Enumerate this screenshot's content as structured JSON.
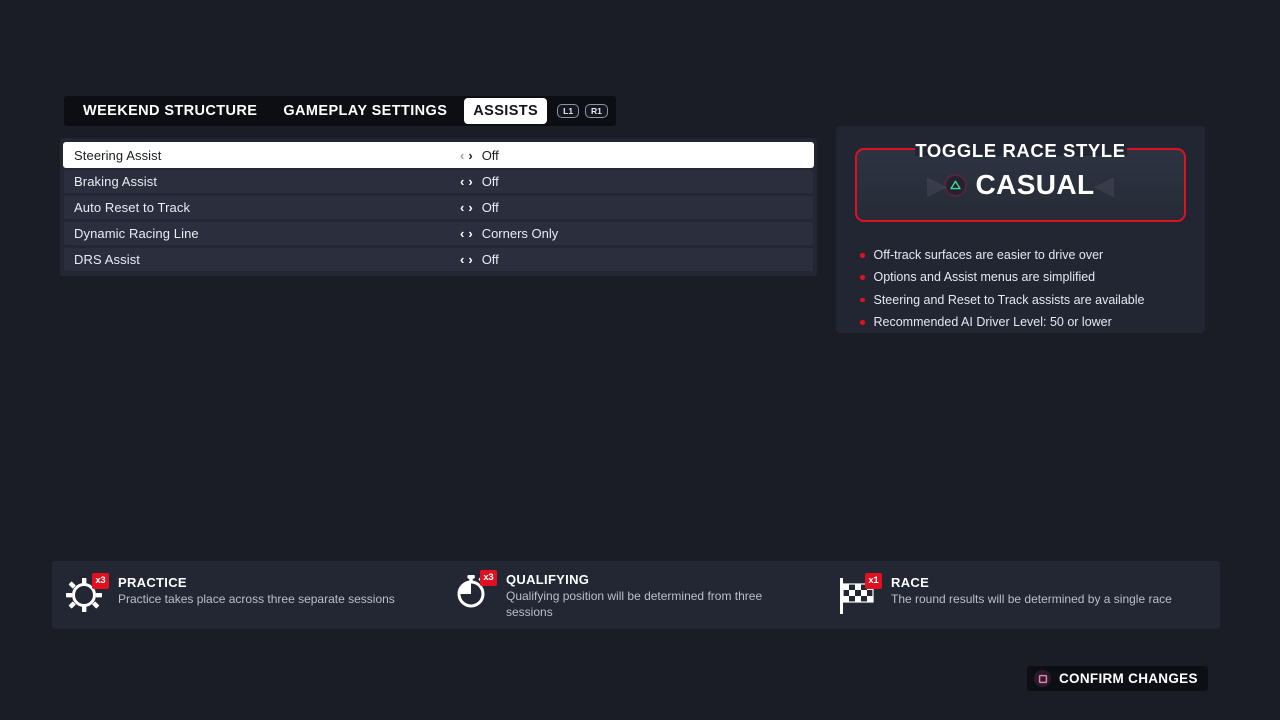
{
  "tabs": [
    {
      "label": "WEEKEND STRUCTURE",
      "active": false
    },
    {
      "label": "GAMEPLAY SETTINGS",
      "active": false
    },
    {
      "label": "ASSISTS",
      "active": true
    }
  ],
  "shoulder_buttons": [
    {
      "label": "L1"
    },
    {
      "label": "R1"
    }
  ],
  "settings_rows": [
    {
      "label": "Steering Assist",
      "value": "Off",
      "selected": true
    },
    {
      "label": "Braking Assist",
      "value": "Off",
      "selected": false
    },
    {
      "label": "Auto Reset to Track",
      "value": "Off",
      "selected": false
    },
    {
      "label": "Dynamic Racing Line",
      "value": "Corners Only",
      "selected": false
    },
    {
      "label": "DRS Assist",
      "value": "Off",
      "selected": false
    }
  ],
  "race_style": {
    "title": "TOGGLE RACE STYLE",
    "value": "CASUAL",
    "button_icon": "playstation-triangle-icon",
    "left_arrow": "◀",
    "right_arrow": "▶",
    "bullets": [
      "Off-track surfaces are easier to drive over",
      "Options and Assist menus are simplified",
      "Steering and Reset to Track assists are available",
      "Recommended AI Driver Level: 50 or lower"
    ]
  },
  "sessions": [
    {
      "title": "PRACTICE",
      "count": "x3",
      "icon": "gear-icon",
      "description": "Practice takes place across three separate sessions"
    },
    {
      "title": "QUALIFYING",
      "count": "x3",
      "icon": "stopwatch-icon",
      "description": "Qualifying position will be determined from three sessions"
    },
    {
      "title": "RACE",
      "count": "x1",
      "icon": "checkered-flag-icon",
      "description": "The round results will be determined by a single race"
    }
  ],
  "confirm": {
    "label": "CONFIRM CHANGES",
    "button_icon": "playstation-square-icon"
  },
  "colors": {
    "background": "#1a1d26",
    "panel": "#232734",
    "row": "#2b2f3d",
    "accent_red": "#e01020",
    "text": "#e9ecf2",
    "triangle_green": "#3ddc97",
    "square_pink": "#e87ab4"
  },
  "chevrons": {
    "left": "‹",
    "right": "›"
  }
}
